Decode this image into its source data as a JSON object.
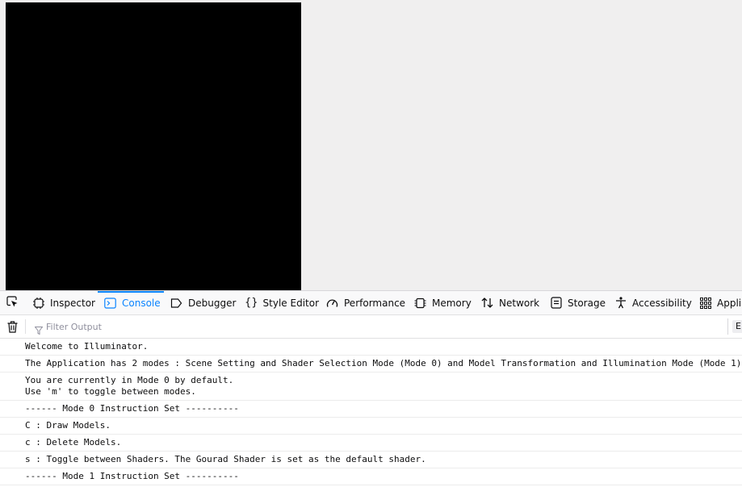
{
  "devtools": {
    "tabs": [
      {
        "label": "Inspector",
        "icon": "inspector-icon"
      },
      {
        "label": "Console",
        "icon": "console-icon",
        "selected": true
      },
      {
        "label": "Debugger",
        "icon": "debugger-icon"
      },
      {
        "label": "Style Editor",
        "icon": "style-editor-icon"
      },
      {
        "label": "Performance",
        "icon": "performance-icon"
      },
      {
        "label": "Memory",
        "icon": "memory-icon"
      },
      {
        "label": "Network",
        "icon": "network-icon"
      },
      {
        "label": "Storage",
        "icon": "storage-icon"
      },
      {
        "label": "Accessibility",
        "icon": "accessibility-icon"
      },
      {
        "label": "Appli",
        "icon": "application-icon"
      }
    ],
    "filter": {
      "placeholder": "Filter Output",
      "value": ""
    },
    "clip_button_label": "E",
    "accent_color": "#0a84ff"
  },
  "console": {
    "messages": [
      "Welcome to Illuminator.",
      "The Application has 2 modes : Scene Setting and Shader Selection Mode (Mode 0) and Model Transformation and Illumination Mode (Mode 1)",
      "You are currently in Mode 0 by default.\nUse 'm' to toggle between modes.",
      "------ Mode 0 Instruction Set ----------",
      "C : Draw Models.",
      "c : Delete Models.",
      "s : Toggle between Shaders. The Gourad Shader is set as the default shader.",
      "------ Mode 1 Instruction Set ----------"
    ]
  },
  "canvas": {
    "background": "#000000"
  }
}
